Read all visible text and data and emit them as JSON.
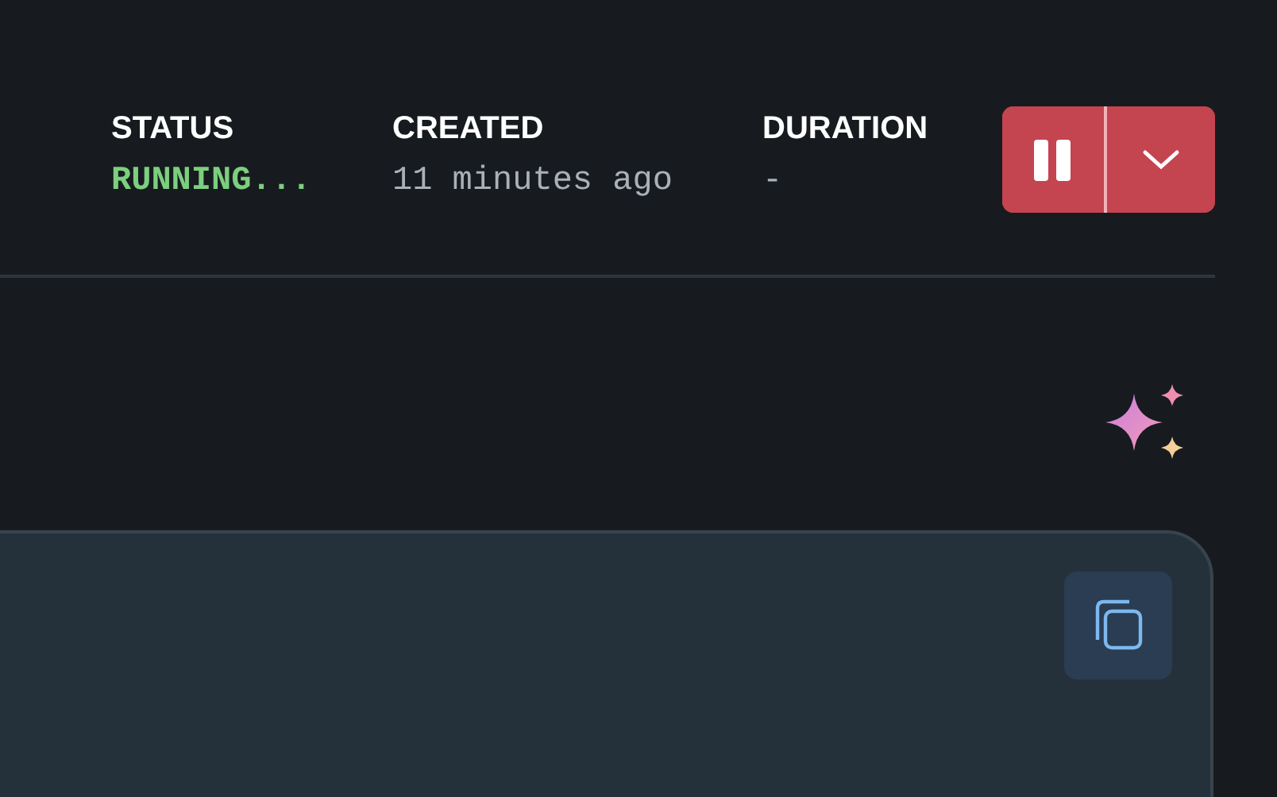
{
  "run_summary": {
    "stats": [
      {
        "label": "STATUS",
        "value": "RUNNING...",
        "kind": "status"
      },
      {
        "label": "CREATED",
        "value": "11 minutes ago",
        "kind": "plain"
      },
      {
        "label": "DURATION",
        "value": "-",
        "kind": "plain"
      }
    ]
  }
}
